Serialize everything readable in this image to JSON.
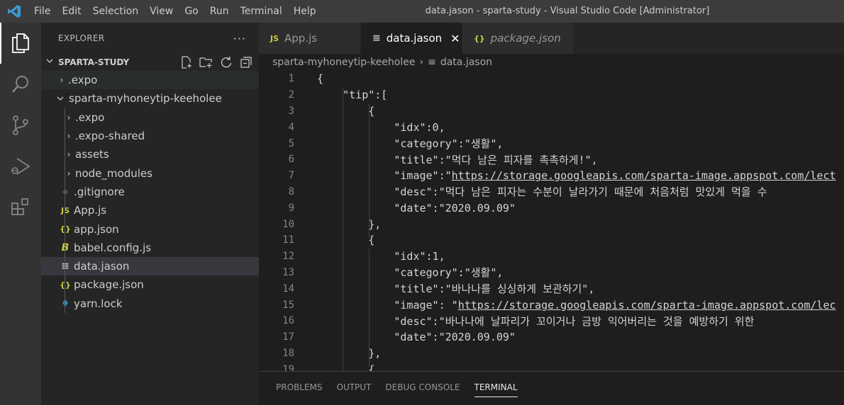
{
  "window_title": "data.jason - sparta-study - Visual Studio Code [Administrator]",
  "menu": [
    "File",
    "Edit",
    "Selection",
    "View",
    "Go",
    "Run",
    "Terminal",
    "Help"
  ],
  "activity_bar": [
    "files-icon",
    "search-icon",
    "source-control-icon",
    "run-debug-icon",
    "extensions-icon"
  ],
  "sidebar": {
    "title": "EXPLORER",
    "more": "···",
    "section_title": "SPARTA-STUDY",
    "items": [
      {
        "label": ".expo",
        "type": "folder",
        "depth": 0
      },
      {
        "label": "sparta-myhoneytip-keeholee",
        "type": "folder-open",
        "depth": 0
      },
      {
        "label": ".expo",
        "type": "folder",
        "depth": 1
      },
      {
        "label": ".expo-shared",
        "type": "folder",
        "depth": 1
      },
      {
        "label": "assets",
        "type": "folder",
        "depth": 1
      },
      {
        "label": "node_modules",
        "type": "folder",
        "depth": 1
      },
      {
        "label": ".gitignore",
        "type": "git",
        "depth": 1
      },
      {
        "label": "App.js",
        "type": "js",
        "depth": 1
      },
      {
        "label": "app.json",
        "type": "json",
        "depth": 1
      },
      {
        "label": "babel.config.js",
        "type": "babel",
        "depth": 1
      },
      {
        "label": "data.jason",
        "type": "text",
        "depth": 1
      },
      {
        "label": "package.json",
        "type": "json",
        "depth": 1
      },
      {
        "label": "yarn.lock",
        "type": "yarn",
        "depth": 1
      }
    ]
  },
  "tabs": [
    {
      "label": "App.js",
      "icon": "JS"
    },
    {
      "label": "data.jason",
      "icon": "≡"
    },
    {
      "label": "package.json",
      "icon": "{}"
    }
  ],
  "breadcrumb": {
    "folder": "sparta-myhoneytip-keeholee",
    "file": "data.jason"
  },
  "code_lines": [
    "{",
    "    \"tip\":[",
    "        {",
    "            \"idx\":0,",
    "            \"category\":\"생활\",",
    "            \"title\":\"먹다 남은 피자를 촉촉하게!\",",
    "            \"image\":\"https://storage.googleapis.com/sparta-image.appspot.com/lect",
    "            \"desc\":\"먹다 남은 피자는 수분이 날라가기 때문에 처음처럼 맛있게 먹을 수",
    "            \"date\":\"2020.09.09\"",
    "        },",
    "        {",
    "            \"idx\":1,",
    "            \"category\":\"생활\",",
    "            \"title\":\"바나나를 싱싱하게 보관하기\",",
    "            \"image\": \"https://storage.googleapis.com/sparta-image.appspot.com/lec",
    "            \"desc\":\"바나나에 날파리가 꼬이거나 금방 익어버리는 것을 예방하기 위한",
    "            \"date\":\"2020.09.09\"",
    "        },",
    "        {"
  ],
  "line_numbers": [
    "1",
    "2",
    "3",
    "4",
    "5",
    "6",
    "7",
    "8",
    "9",
    "10",
    "11",
    "12",
    "13",
    "14",
    "15",
    "16",
    "17",
    "18",
    "19"
  ],
  "panel_tabs": [
    "PROBLEMS",
    "OUTPUT",
    "DEBUG CONSOLE",
    "TERMINAL"
  ]
}
